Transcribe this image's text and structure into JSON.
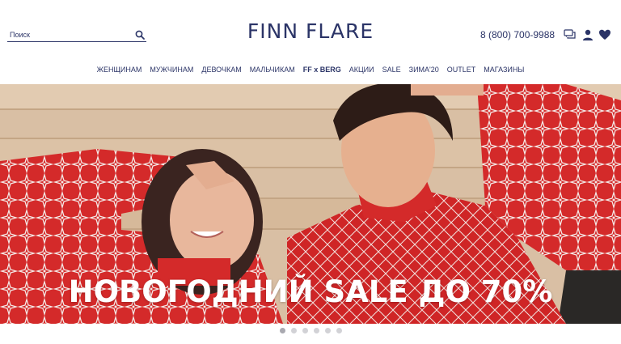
{
  "search": {
    "placeholder": "Поиск"
  },
  "logo": {
    "text": "FINN FLARE"
  },
  "header": {
    "phone": "8 (800) 700-9988"
  },
  "nav": {
    "items": [
      {
        "label": "ЖЕНЩИНАМ"
      },
      {
        "label": "МУЖЧИНАМ"
      },
      {
        "label": "ДЕВОЧКАМ"
      },
      {
        "label": "МАЛЬЧИКАМ"
      },
      {
        "label": "FF x BERG"
      },
      {
        "label": "АКЦИИ"
      },
      {
        "label": "SALE"
      },
      {
        "label": "ЗИМА'20"
      },
      {
        "label": "OUTLET"
      },
      {
        "label": "МАГАЗИНЫ"
      }
    ]
  },
  "hero": {
    "title": "НОВОГОДНИЙ SALE ДО 70%"
  },
  "carousel": {
    "slide_count": 6,
    "active_index": 0
  },
  "icons": {
    "search": "search-icon",
    "chat": "chat-icon",
    "account": "user-icon",
    "favorites": "heart-icon"
  },
  "colors": {
    "brand": "#2b3467",
    "sweater_red": "#d42a2a",
    "wood": "#d9bfa4"
  }
}
